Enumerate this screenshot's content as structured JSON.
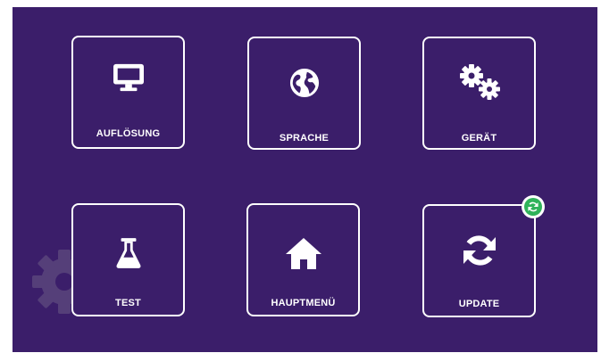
{
  "menu": {
    "tiles": [
      {
        "label": "AUFLÖSUNG",
        "icon": "monitor-icon"
      },
      {
        "label": "SPRACHE",
        "icon": "globe-icon"
      },
      {
        "label": "GERÄT",
        "icon": "gears-icon"
      },
      {
        "label": "TEST",
        "icon": "flask-icon"
      },
      {
        "label": "HAUPTMENÜ",
        "icon": "home-icon"
      },
      {
        "label": "UPDATE",
        "icon": "sync-icon"
      }
    ],
    "update_badge_icon": "sync-badge-icon",
    "background_icon": "gear-watermark-icon"
  },
  "colors": {
    "background": "#3b1e6a",
    "tile_border": "#ffffff",
    "text": "#ffffff",
    "badge": "#2fb35a"
  }
}
